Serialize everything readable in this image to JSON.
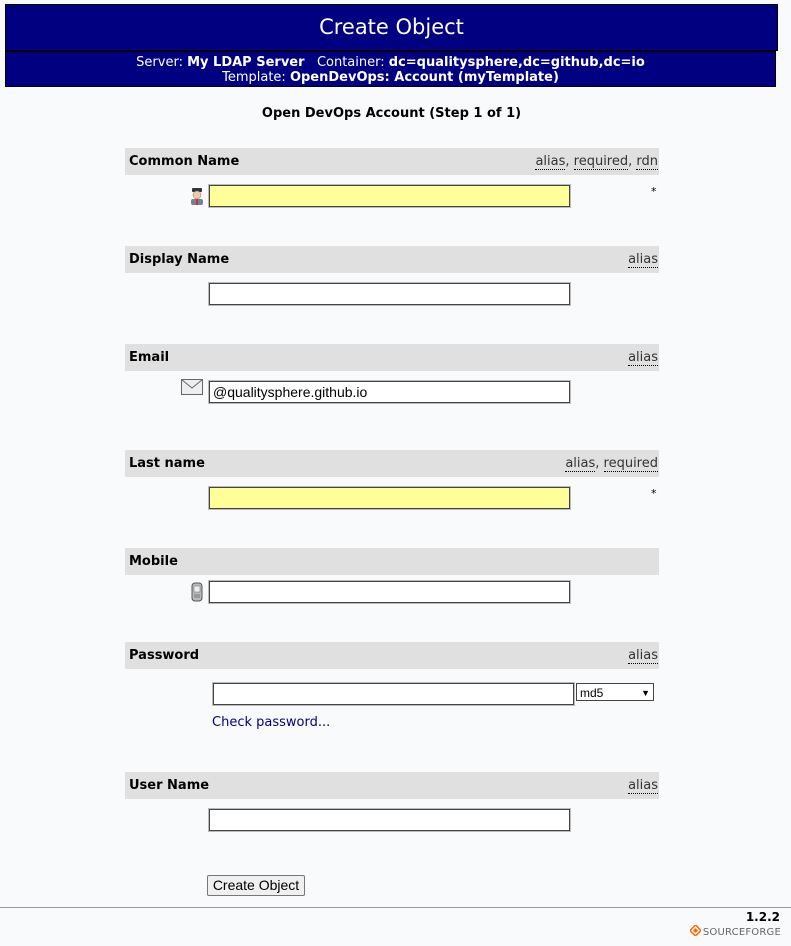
{
  "header": {
    "title": "Create Object",
    "server_label": "Server:",
    "server_value": "My LDAP Server",
    "container_label": "Container:",
    "container_value": "dc=qualitysphere,dc=github,dc=io",
    "template_label": "Template:",
    "template_value": "OpenDevOps: Account (myTemplate)"
  },
  "step_title": "Open DevOps Account (Step 1 of 1)",
  "fields": {
    "common_name": {
      "label": "Common Name",
      "tag1": "alias",
      "tag2": "required",
      "tag3": "rdn",
      "value": "",
      "required_mark": "*",
      "icon": "user-icon"
    },
    "display_name": {
      "label": "Display Name",
      "tag1": "alias",
      "value": ""
    },
    "email": {
      "label": "Email",
      "tag1": "alias",
      "value": "@qualitysphere.github.io",
      "icon": "envelope-icon"
    },
    "last_name": {
      "label": "Last name",
      "tag1": "alias",
      "tag2": "required",
      "value": "",
      "required_mark": "*"
    },
    "mobile": {
      "label": "Mobile",
      "value": "",
      "icon": "mobile-phone-icon"
    },
    "password": {
      "label": "Password",
      "tag1": "alias",
      "value": "",
      "hash": "md5",
      "check_link": "Check password..."
    },
    "user_name": {
      "label": "User Name",
      "tag1": "alias",
      "value": ""
    }
  },
  "submit_label": "Create Object",
  "footer": {
    "version": "1.2.2",
    "brand": "SOURCEFORGE"
  },
  "colors": {
    "header_bg": "#000080",
    "bar_bg": "#e0e0e0",
    "required_bg": "#ffff99",
    "link": "#000080"
  }
}
